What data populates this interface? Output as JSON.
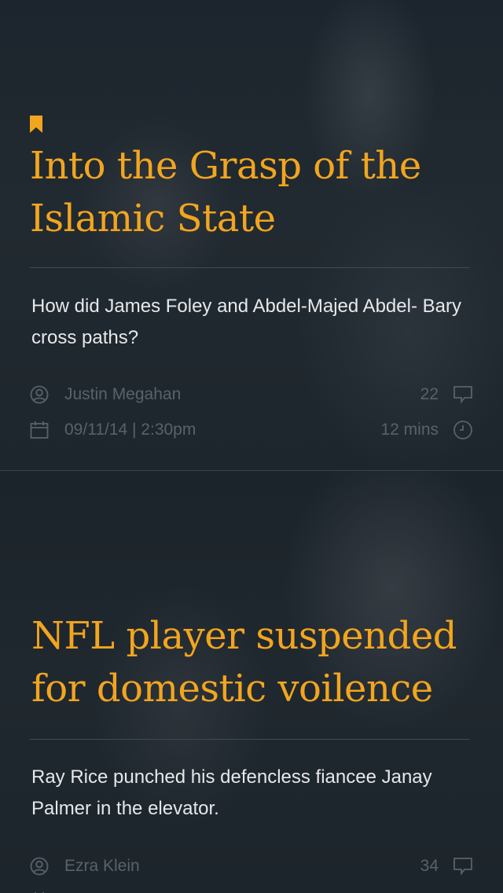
{
  "colors": {
    "accent": "#f2a51f",
    "summary_text": "#e6e8ea",
    "meta_text": "#58626b",
    "background": "#1b2229"
  },
  "articles": [
    {
      "bookmarked": true,
      "title": "Into the Grasp of the Islamic State",
      "summary": "How did James Foley and Abdel-Majed Abdel- Bary cross paths?",
      "author": "Justin Megahan",
      "date": "09/11/14 | 2:30pm",
      "comments": "22",
      "read_time": "12 mins",
      "icons": {
        "author": "user-icon",
        "date": "calendar-icon",
        "comments": "comment-icon",
        "read_time": "clock-icon"
      }
    },
    {
      "bookmarked": false,
      "title": "NFL player suspended for domestic voilence",
      "summary": "Ray Rice punched his defencless fiancee Janay Palmer in the elevator.",
      "author": "Ezra Klein",
      "comments": "34",
      "icons": {
        "author": "user-icon",
        "comments": "comment-icon"
      }
    }
  ]
}
